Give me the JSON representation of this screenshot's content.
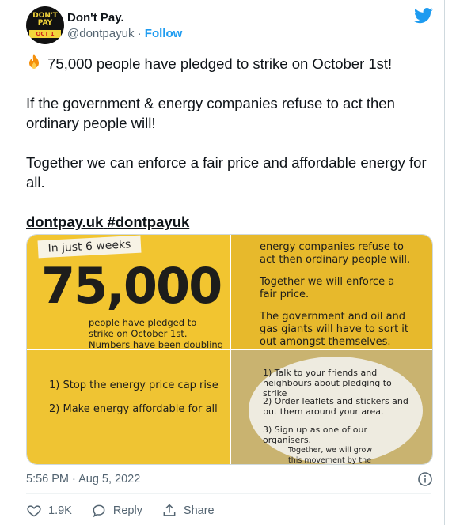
{
  "account": {
    "name": "Don't Pay.",
    "handle": "@dontpayuk",
    "separator": "·",
    "follow_label": "Follow",
    "avatar": {
      "line1": "DON'T",
      "line2": "PAY",
      "badge": "OCT 1"
    }
  },
  "tweet": {
    "line1": "75,000 people have pledged to strike on October 1st!",
    "line2": "If the government & energy companies refuse to act then ordinary people will!",
    "line3": "Together we can enforce a fair price and affordable energy for all.",
    "link1": "dontpay.uk",
    "link2": "#dontpayuk"
  },
  "media": {
    "tile1": {
      "label": "In just 6 weeks",
      "number": "75,000",
      "caption": "people have pledged to strike on October 1st. Numbers have been doubling every week!"
    },
    "tile2": {
      "text1": "energy companies refuse to act then ordinary people will.",
      "text2": "Together we will enforce a fair price.",
      "text3": "The government and oil and gas giants will have to sort it out amongst themselves."
    },
    "tile3": {
      "item1": "1) Stop the energy price cap rise",
      "item2": "2) Make energy affordable for all"
    },
    "tile4": {
      "item1": "1) Talk to your friends and neighbours about pledging to strike",
      "item2": "2) Order leaflets and stickers and put them around your area.",
      "item3": "3) Sign up as one of our organisers.",
      "footer": "Together, we will grow this movement by the millions"
    }
  },
  "meta": {
    "timestamp": "5:56 PM · Aug 5, 2022"
  },
  "actions": {
    "likes": "1.9K",
    "reply_label": "Reply",
    "share_label": "Share"
  },
  "colors": {
    "accent": "#1d9bf0",
    "text": "#0f1419",
    "muted": "#536471",
    "yellow": "#f2c530"
  }
}
